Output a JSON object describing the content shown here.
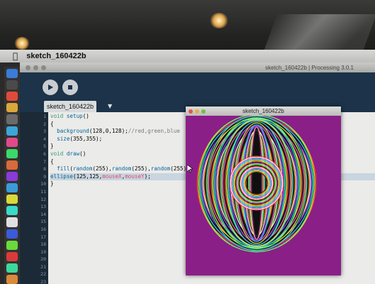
{
  "menubar": {
    "apple_icon": "apple-icon",
    "app_title": "sketch_160422b"
  },
  "editor_window": {
    "title": "sketch_160422b | Processing 3.0.1",
    "tab_label": "sketch_160422b",
    "tab_arrow": "▼",
    "line_numbers": [
      "1",
      "2",
      "3",
      "4",
      "5",
      "6",
      "7",
      "8",
      "9",
      "10",
      "11",
      "12",
      "13",
      "14",
      "15",
      "16",
      "17",
      "18",
      "19",
      "20",
      "21",
      "22",
      "23"
    ],
    "code": [
      {
        "segments": [
          [
            "kw",
            "void "
          ],
          [
            "fn",
            "setup"
          ],
          [
            "",
            "()"
          ]
        ]
      },
      {
        "segments": [
          [
            "",
            "{"
          ]
        ]
      },
      {
        "segments": [
          [
            "fn",
            "  background"
          ],
          [
            "",
            "(128,0,128);"
          ],
          [
            "cm",
            "//red,green,blue"
          ]
        ]
      },
      {
        "segments": [
          [
            "fn",
            "  size"
          ],
          [
            "",
            "(355,355);"
          ]
        ]
      },
      {
        "segments": [
          [
            "",
            "}"
          ]
        ]
      },
      {
        "segments": [
          [
            "kw",
            "void "
          ],
          [
            "fn",
            "draw"
          ],
          [
            "",
            "()"
          ]
        ]
      },
      {
        "segments": [
          [
            "",
            "{"
          ]
        ]
      },
      {
        "segments": [
          [
            "fn",
            "  fill"
          ],
          [
            "",
            "("
          ],
          [
            "fn",
            "random"
          ],
          [
            "",
            "(255),"
          ],
          [
            "fn",
            "random"
          ],
          [
            "",
            "(255),"
          ],
          [
            "fn",
            "random"
          ],
          [
            "",
            "(255)"
          ]
        ]
      },
      {
        "segments": [
          [
            "fn",
            "ellipse"
          ],
          [
            "",
            "(125,125,"
          ],
          [
            "vr",
            "mouseX"
          ],
          [
            "",
            ","
          ],
          [
            "vr",
            "mouseY"
          ],
          [
            "",
            ");"
          ]
        ]
      },
      {
        "segments": [
          [
            "",
            "}"
          ]
        ]
      }
    ]
  },
  "sketch_window": {
    "title": "sketch_160422b",
    "background_color": "#8a1f88"
  },
  "colors": {
    "accent": "#1c3349",
    "sketch_bg": "#8a1f88"
  }
}
